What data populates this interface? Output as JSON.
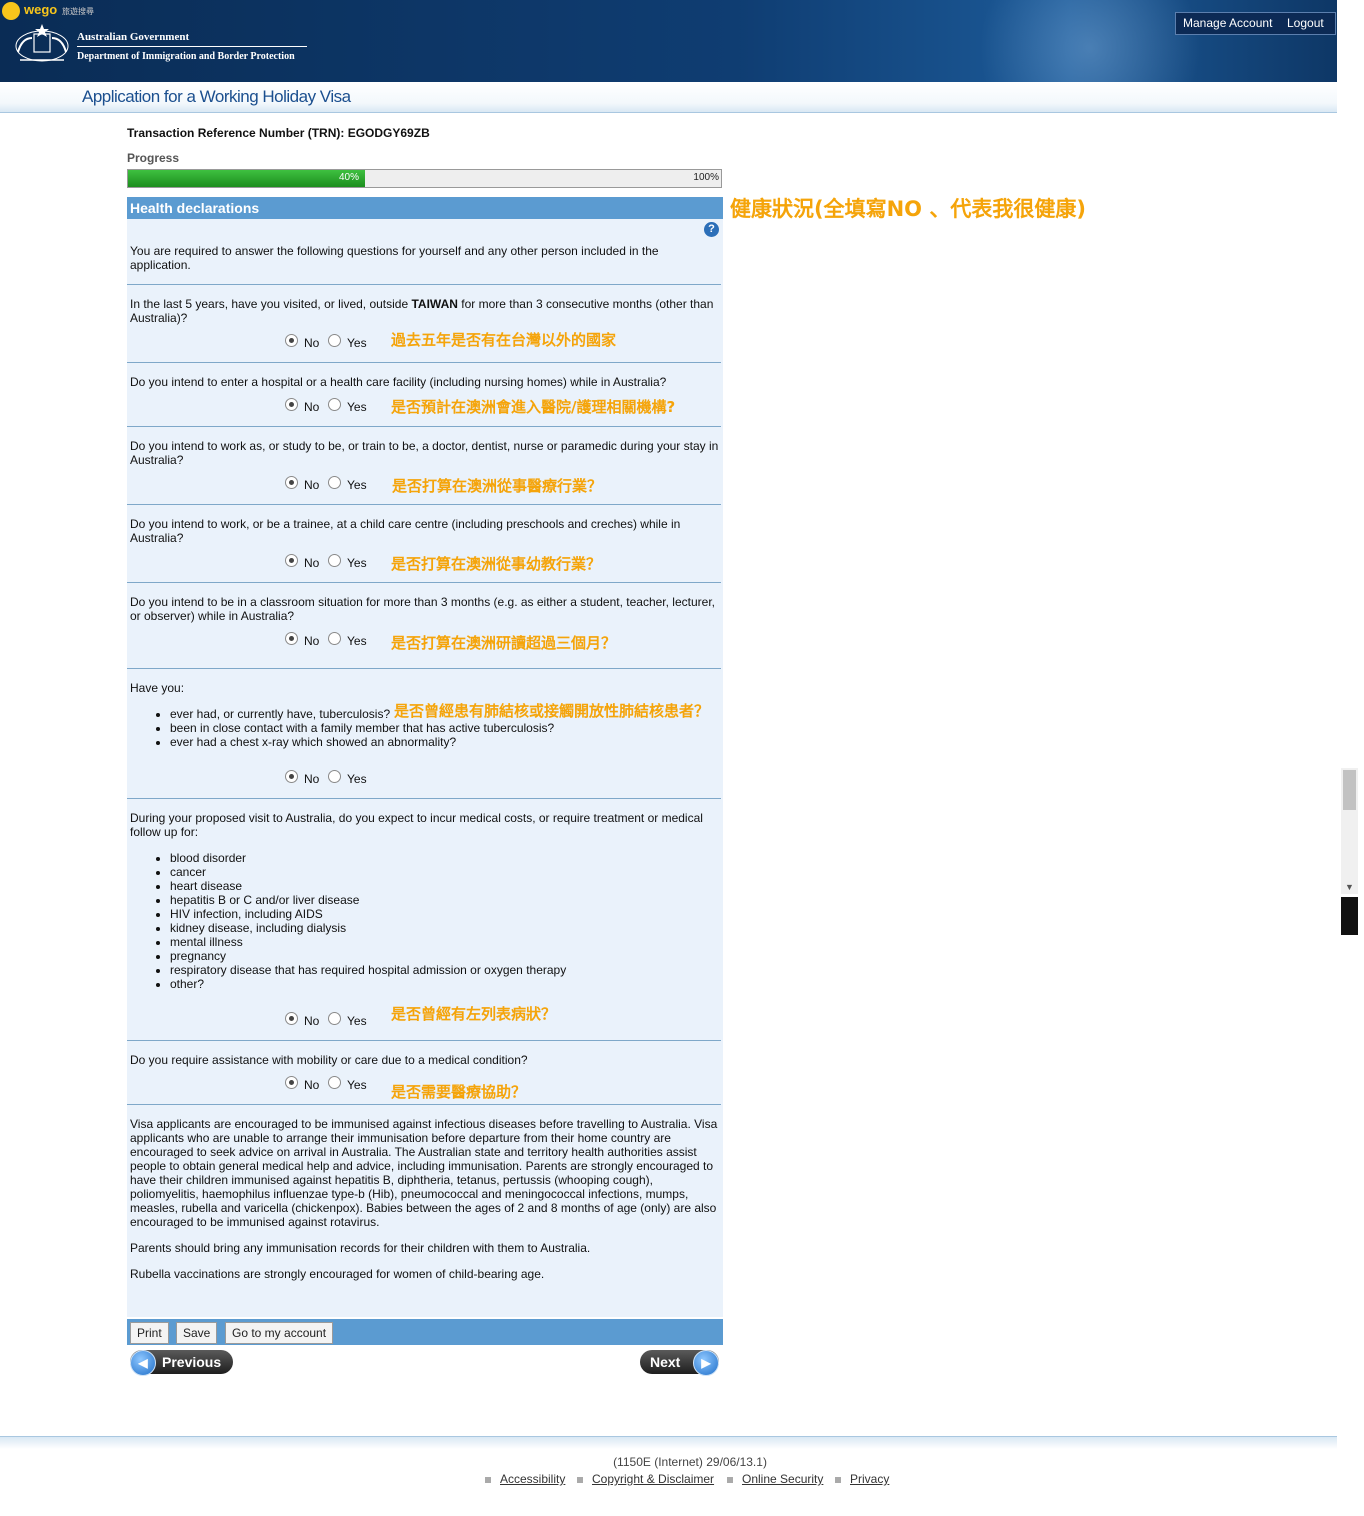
{
  "header": {
    "wego_logo": "wego",
    "wego_sub": "旅遊搜尋",
    "gov_line1": "Australian Government",
    "gov_line2": "Department of Immigration and Border Protection",
    "manage_account": "Manage Account",
    "logout": "Logout"
  },
  "page": {
    "app_title": "Application for a Working Holiday Visa",
    "trn_label": "Transaction Reference Number (TRN): EGODGY69ZB",
    "progress_label": "Progress",
    "progress_value": "40%",
    "progress_max": "100%",
    "progress_fraction": 0.4
  },
  "section": {
    "title": "Health declarations",
    "intro": "You are required to answer the following questions for yourself and any other person included in the application.",
    "help_icon": "help-icon"
  },
  "questions": [
    {
      "pre": "In the last 5 years, have you visited, or lived, outside ",
      "bold": "TAIWAN",
      "post": " for more than 3 consecutive months (other than Australia)?",
      "answer": "No"
    },
    {
      "text": "Do you intend to enter a hospital or a health care facility (including nursing homes) while in Australia?",
      "answer": "No"
    },
    {
      "text": "Do you intend to work as, or study to be, or train to be, a doctor, dentist, nurse or paramedic during your stay in Australia?",
      "answer": "No"
    },
    {
      "text": "Do you intend to work, or be a trainee, at a child care centre (including preschools and creches) while in Australia?",
      "answer": "No"
    },
    {
      "text": "Do you intend to be in a classroom situation for more than 3 months (e.g. as either a student, teacher, lecturer, or observer) while in Australia?",
      "answer": "No"
    },
    {
      "text": "Have you:",
      "bullets": [
        "ever had, or currently have, tuberculosis?",
        "been in close contact with a family member that has active tuberculosis?",
        "ever had a chest x-ray which showed an abnormality?"
      ],
      "answer": "No"
    },
    {
      "text": "During your proposed visit to Australia, do you expect to incur medical costs, or require treatment or medical follow up for:",
      "bullets": [
        "blood disorder",
        "cancer",
        "heart disease",
        "hepatitis B or C and/or liver disease",
        "HIV infection, including AIDS",
        "kidney disease, including dialysis",
        "mental illness",
        "pregnancy",
        "respiratory disease that has required hospital admission or oxygen therapy",
        "other?"
      ],
      "answer": "No"
    },
    {
      "text": "Do you require assistance with mobility or care due to a medical condition?",
      "answer": "No"
    }
  ],
  "radio": {
    "no": "No",
    "yes": "Yes"
  },
  "info": {
    "p1": "Visa applicants are encouraged to be immunised against infectious diseases before travelling to Australia. Visa applicants who are unable to arrange their immunisation before departure from their home country are encouraged to seek advice on arrival in Australia. The Australian state and territory health authorities assist people to obtain general medical help and advice, including immunisation. Parents are strongly encouraged to have their children immunised against hepatitis B, diphtheria, tetanus, pertussis (whooping cough), poliomyelitis, haemophilus influenzae type-b (Hib), pneumococcal and meningococcal infections, mumps, measles, rubella and varicella (chickenpox). Babies between the ages of 2 and 8 months of age (only) are also encouraged to be immunised against rotavirus.",
    "p2": "Parents should bring any immunisation records for their children with them to Australia.",
    "p3": "Rubella vaccinations are strongly encouraged for women of child-bearing age."
  },
  "buttons": {
    "print": "Print",
    "save": "Save",
    "goto_account": "Go to my account",
    "previous": "Previous",
    "next": "Next"
  },
  "annotations": {
    "main": "健康狀況(全填寫NO 、代表我很健康)",
    "q1": "過去五年是否有在台灣以外的國家",
    "q2": "是否預計在澳洲會進入醫院/護理相關機構?",
    "q3": "是否打算在澳洲從事醫療行業？",
    "q4": "是否打算在澳洲從事幼教行業？",
    "q5": "是否打算在澳洲研讀超過三個月？",
    "q6": "是否曾經患有肺結核或接觸開放性肺結核患者？",
    "q7": "是否曾經有左列表病狀？",
    "q8": "是否需要醫療協助？",
    "color": "#f5a40a"
  },
  "footer": {
    "version": "(1150E (Internet) 29/06/13.1)",
    "links": [
      "Accessibility",
      "Copyright & Disclaimer",
      "Online Security",
      "Privacy"
    ]
  }
}
